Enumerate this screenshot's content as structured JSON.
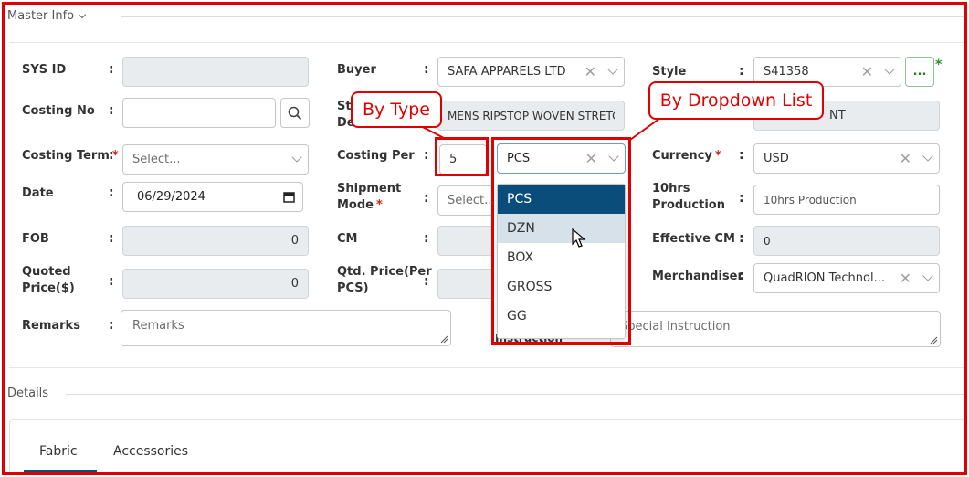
{
  "master_info": {
    "title": "Master Info"
  },
  "fields": {
    "sys_id": {
      "label": "SYS ID",
      "value": ""
    },
    "costing_no": {
      "label": "Costing No",
      "value": ""
    },
    "costing_term": {
      "label": "Costing Term",
      "required_mark": "*",
      "placeholder": "Select..."
    },
    "date": {
      "label": "Date",
      "value": "06/29/2024"
    },
    "fob": {
      "label": "FOB",
      "value": "0"
    },
    "quoted_price": {
      "label_line1": "Quoted",
      "label_line2": "Price($)",
      "value": "0"
    },
    "remarks": {
      "label": "Remarks",
      "placeholder": "Remarks"
    },
    "buyer": {
      "label": "Buyer",
      "value": "SAFA APPARELS LTD"
    },
    "style_desc": {
      "label_partial_1": "St",
      "label_partial_2": "De",
      "value": "MENS RIPSTOP WOVEN STRETC"
    },
    "costing_per": {
      "label": "Costing Per",
      "qty": "5",
      "unit": "PCS"
    },
    "shipment_mode": {
      "label_line1": "Shipment",
      "label_line2": "Mode",
      "required_mark": "*",
      "placeholder": "Select..."
    },
    "cm": {
      "label": "CM"
    },
    "qtd_price_per_pcs": {
      "label_line1": "Qtd. Price(Per",
      "label_line2": "PCS)"
    },
    "special_instruction": {
      "label_partial": "Instruction",
      "placeholder": "Special Instruction"
    },
    "style": {
      "label": "Style",
      "value": "S41358",
      "more_label": "...",
      "required_mark": "*"
    },
    "style_text_partial": {
      "value": "NT"
    },
    "currency": {
      "label": "Currency",
      "required_mark": "*",
      "value": "USD"
    },
    "production_10hrs": {
      "label_line1": "10hrs",
      "label_line2": "Production",
      "placeholder": "10hrs Production"
    },
    "effective_cm": {
      "label": "Effective CM",
      "value": "0"
    },
    "merchandiser": {
      "label": "Merchandiser",
      "value": "QuadRION Technol..."
    }
  },
  "unit_dropdown": {
    "options": [
      "PCS",
      "DZN",
      "BOX",
      "GROSS",
      "GG"
    ],
    "selected": "PCS",
    "hovered": "DZN"
  },
  "callouts": {
    "by_type": "By Type",
    "by_dropdown": "By Dropdown List"
  },
  "details": {
    "title": "Details",
    "tabs": [
      {
        "label": "Fabric",
        "active": true
      },
      {
        "label": "Accessories",
        "active": false
      }
    ]
  },
  "colors": {
    "accent": "#0a4d7a",
    "annotation_red": "#e10000",
    "required_star": "#d9230f",
    "readonly_bg": "#e9ecef",
    "hover_bg": "#d7e1ea",
    "style_more_star": "#2e8b2e"
  }
}
